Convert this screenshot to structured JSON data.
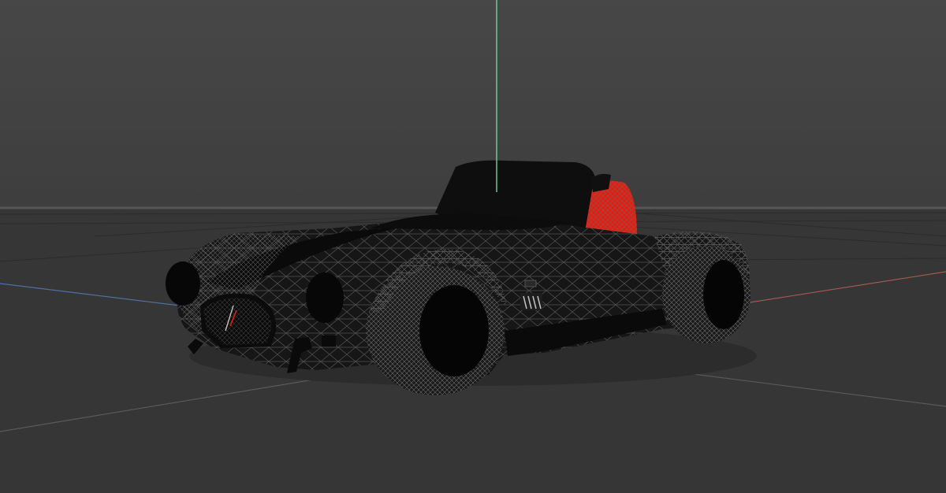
{
  "viewport": {
    "colors": {
      "background_top": "#474747",
      "background_horizon": "#3e3e3e",
      "floor": "#363636",
      "grid_line": "#2b2b2b",
      "horizon_line": "#565656",
      "axis_x": "#a35a4f",
      "axis_y": "#6dd3a6",
      "axis_z": "#4f6fa3",
      "model_body": "#161616",
      "wireframe": "#5a5a5a",
      "seat_highlight": "#e01e12"
    },
    "model": {
      "icon": "car-wireframe-model",
      "display_mode": "wireframe"
    }
  }
}
